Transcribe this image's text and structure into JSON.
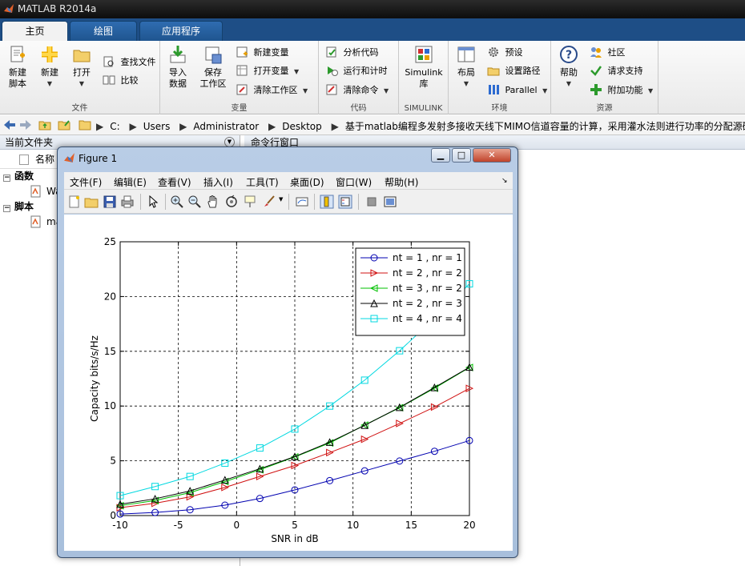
{
  "app": {
    "title": "MATLAB R2014a"
  },
  "tabs": [
    {
      "label": "主页"
    },
    {
      "label": "绘图"
    },
    {
      "label": "应用程序"
    }
  ],
  "ribbon": {
    "file": {
      "label": "文件",
      "new_script": "新建\n脚本",
      "new_script_l1": "新建",
      "new_script_l2": "脚本",
      "new": "新建",
      "open": "打开",
      "find_files": "查找文件",
      "compare": "比较"
    },
    "variable": {
      "label": "变量",
      "import_l1": "导入",
      "import_l2": "数据",
      "save_l1": "保存",
      "save_l2": "工作区",
      "new_variable": "新建变量",
      "open_variable": "打开变量",
      "clear_workspace": "清除工作区"
    },
    "code": {
      "label": "代码",
      "analyze": "分析代码",
      "run_time": "运行和计时",
      "clear_commands": "清除命令"
    },
    "simulink": {
      "label": "SIMULINK",
      "btn_l1": "Simulink",
      "btn_l2": "库"
    },
    "environment": {
      "label": "环境",
      "layout": "布局",
      "preferences": "预设",
      "set_path": "设置路径",
      "parallel": "Parallel"
    },
    "resources": {
      "label": "资源",
      "help": "帮助",
      "community": "社区",
      "request_support": "请求支持",
      "addons": "附加功能"
    }
  },
  "address": {
    "path": [
      "C:",
      "Users",
      "Administrator",
      "Desktop",
      "基于matlab编程多发射多接收天线下MIMO信道容量的计算，采用灌水法则进行功率的分配源码程序"
    ]
  },
  "current_folder": {
    "header": "当前文件夹",
    "column_name": "名称",
    "groups": [
      {
        "label": "函数",
        "items": [
          "Wa"
        ]
      },
      {
        "label": "脚本",
        "items": [
          "ma"
        ]
      }
    ]
  },
  "command_window": {
    "header": "命令行窗口"
  },
  "figure": {
    "title": "Figure 1",
    "menu": [
      "文件(F)",
      "编辑(E)",
      "查看(V)",
      "插入(I)",
      "工具(T)",
      "桌面(D)",
      "窗口(W)",
      "帮助(H)"
    ],
    "controls": {
      "minimize": "▁",
      "maximize": "□",
      "close": "✕"
    }
  },
  "chart_data": {
    "type": "line",
    "xlabel": "SNR in dB",
    "ylabel": "Capacity bits/s/Hz",
    "xlim": [
      -10,
      20
    ],
    "ylim": [
      0,
      25
    ],
    "xticks": [
      -10,
      -5,
      0,
      5,
      10,
      15,
      20
    ],
    "yticks": [
      0,
      5,
      10,
      15,
      20,
      25
    ],
    "grid": true,
    "legend_position": "top-right",
    "x": [
      -10,
      -7,
      -4,
      -1,
      2,
      5,
      8,
      11,
      14,
      17,
      20
    ],
    "series": [
      {
        "name": "nt = 1 , nr = 1",
        "color": "#0000b0",
        "marker": "circle",
        "values": [
          0.14,
          0.28,
          0.53,
          0.95,
          1.56,
          2.34,
          3.19,
          4.08,
          4.98,
          5.87,
          6.85
        ]
      },
      {
        "name": "nt = 2 , nr = 2",
        "color": "#d01010",
        "marker": "triangle-right",
        "values": [
          0.72,
          1.12,
          1.71,
          2.57,
          3.57,
          4.57,
          5.75,
          6.97,
          8.41,
          9.91,
          11.61
        ]
      },
      {
        "name": "nt = 3 , nr = 2",
        "color": "#00c000",
        "marker": "triangle-left",
        "values": [
          0.9,
          1.37,
          2.09,
          3.1,
          4.18,
          5.35,
          6.63,
          8.26,
          9.85,
          11.63,
          13.52
        ]
      },
      {
        "name": "nt = 2 , nr = 3",
        "color": "#000000",
        "marker": "triangle-up",
        "values": [
          1.03,
          1.53,
          2.25,
          3.25,
          4.27,
          5.38,
          6.7,
          8.24,
          9.88,
          11.69,
          13.55
        ]
      },
      {
        "name": "nt = 4 , nr = 4",
        "color": "#00d8e0",
        "marker": "square",
        "values": [
          1.82,
          2.65,
          3.57,
          4.79,
          6.17,
          7.9,
          10.0,
          12.36,
          15.05,
          17.99,
          21.16
        ]
      }
    ]
  }
}
